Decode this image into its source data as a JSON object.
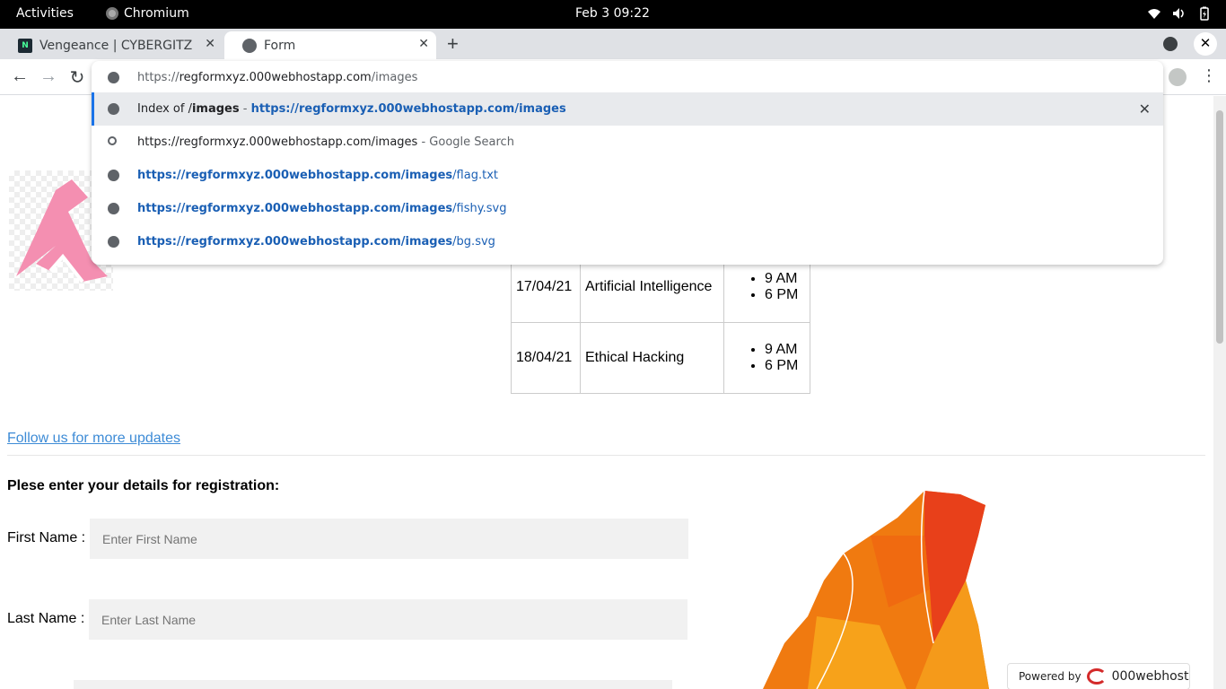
{
  "system": {
    "activities": "Activities",
    "app_name": "Chromium",
    "clock": "Feb 3  09:22"
  },
  "tabs": [
    {
      "title": "Vengeance | CYBERGITZ C",
      "favicon": "nh-favicon-icon"
    },
    {
      "title": "Form",
      "favicon": "globe-icon"
    }
  ],
  "omnibox": {
    "input_prefix": "https://",
    "input_host": "regformxyz.000webhostapp.com",
    "input_path": "/images",
    "suggestions": [
      {
        "prefix": "Index of /",
        "bold": "images",
        "sep": " - ",
        "url": "https://regformxyz.000webhostapp.com/images",
        "icon": "globe-icon"
      },
      {
        "text": "https://regformxyz.000webhostapp.com/images",
        "suffix": " - Google Search",
        "icon": "search-icon"
      },
      {
        "url_bold": "https://regformxyz.000webhostapp.com/images",
        "url_rest": "/flag.txt",
        "icon": "globe-icon"
      },
      {
        "url_bold": "https://regformxyz.000webhostapp.com/images",
        "url_rest": "/fishy.svg",
        "icon": "globe-icon"
      },
      {
        "url_bold": "https://regformxyz.000webhostapp.com/images",
        "url_rest": "/bg.svg",
        "icon": "globe-icon"
      }
    ]
  },
  "schedule": [
    {
      "date": "17/04/21",
      "topic": "Artificial Intelligence",
      "times": [
        "9 AM",
        "6 PM"
      ]
    },
    {
      "date": "18/04/21",
      "topic": "Ethical Hacking",
      "times": [
        "9 AM",
        "6 PM"
      ]
    }
  ],
  "follow_link": "Follow us for more updates",
  "form": {
    "heading": "Plese enter your details for registration:",
    "first_name_label": "First Name :",
    "first_name_placeholder": "Enter First Name",
    "last_name_label": "Last Name :",
    "last_name_placeholder": "Enter Last Name"
  },
  "powered_by": {
    "label": "Powered by",
    "brand": "000webhost"
  },
  "colors": {
    "link": "#3d8bd6",
    "omni_url_blue": "#1a5fb4",
    "map_orange": "#f07a10",
    "logo_pink": "#f48fb1"
  }
}
